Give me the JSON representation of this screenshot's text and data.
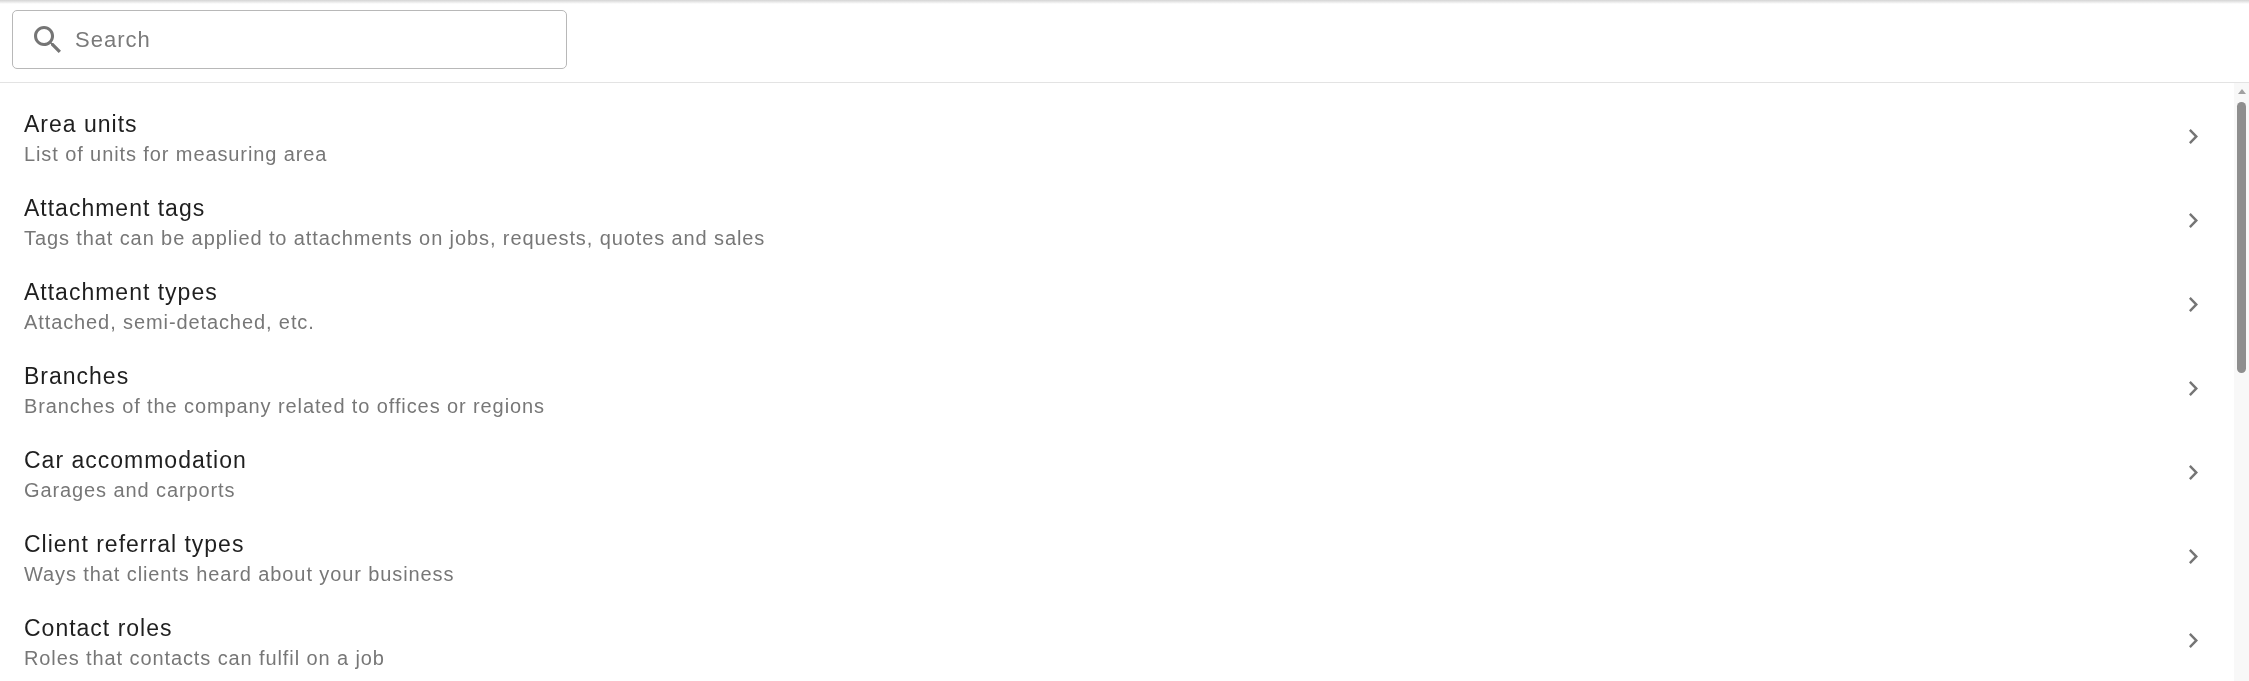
{
  "search": {
    "placeholder": "Search"
  },
  "items": [
    {
      "title": "Area units",
      "description": "List of units for measuring area"
    },
    {
      "title": "Attachment tags",
      "description": "Tags that can be applied to attachments on jobs, requests, quotes and sales"
    },
    {
      "title": "Attachment types",
      "description": "Attached, semi-detached, etc."
    },
    {
      "title": "Branches",
      "description": "Branches of the company related to offices or regions"
    },
    {
      "title": "Car accommodation",
      "description": "Garages and carports"
    },
    {
      "title": "Client referral types",
      "description": "Ways that clients heard about your business"
    },
    {
      "title": "Contact roles",
      "description": "Roles that contacts can fulfil on a job"
    }
  ]
}
